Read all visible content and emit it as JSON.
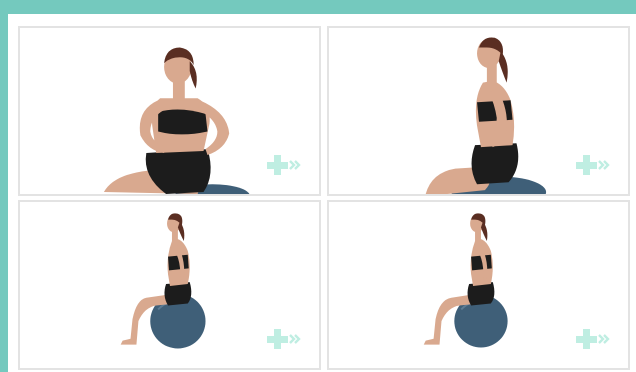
{
  "colors": {
    "accent": "#74c9be",
    "icon": "#bfeee2",
    "card_border": "#e3e3e3",
    "ball": "#3f5f78",
    "skin": "#d9a98f",
    "clothing": "#1c1c1c",
    "hair": "#5a2e22"
  },
  "gallery": {
    "cards": [
      {
        "id": "card-1",
        "view": "close-up-front",
        "icon": "expand-plus-arrows-icon"
      },
      {
        "id": "card-2",
        "view": "close-up-side",
        "icon": "expand-plus-arrows-icon"
      },
      {
        "id": "card-3",
        "view": "full-side-start",
        "icon": "expand-plus-arrows-icon"
      },
      {
        "id": "card-4",
        "view": "full-side-end",
        "icon": "expand-plus-arrows-icon"
      }
    ]
  }
}
